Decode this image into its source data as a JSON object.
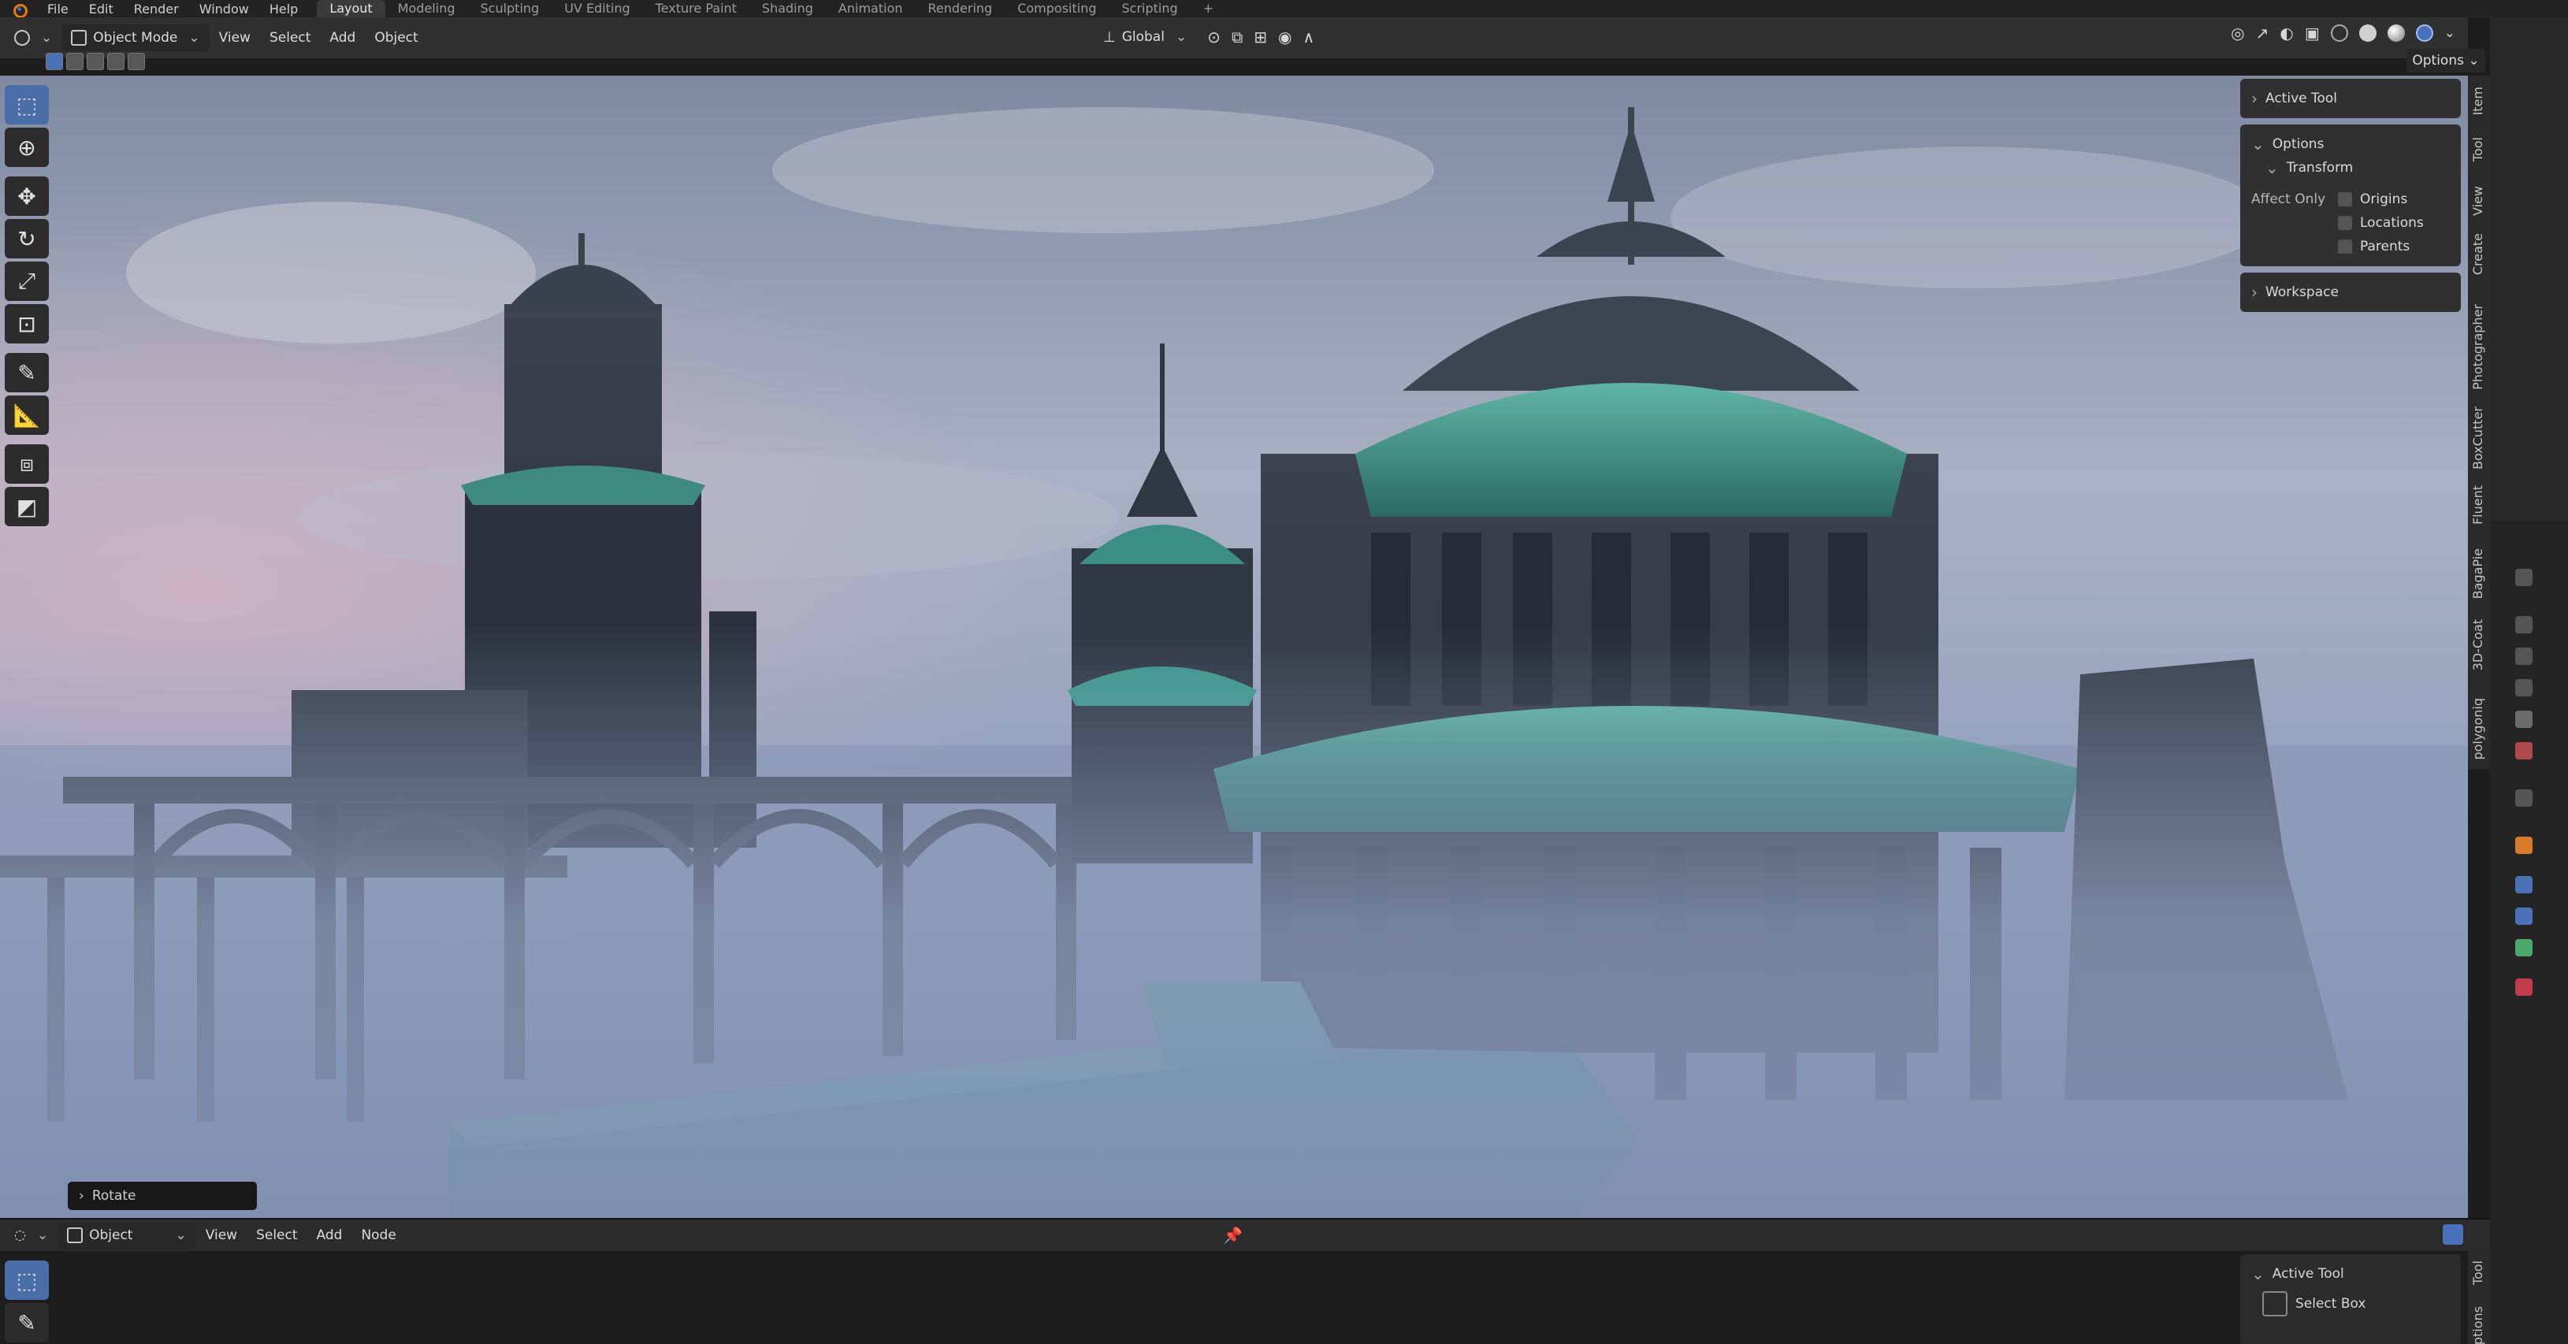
{
  "topbar": {
    "menu": [
      "File",
      "Edit",
      "Render",
      "Window",
      "Help"
    ],
    "workspaces": [
      "Layout",
      "Modeling",
      "Sculpting",
      "UV Editing",
      "Texture Paint",
      "Shading",
      "Animation",
      "Rendering",
      "Compositing",
      "Scripting",
      "+"
    ],
    "active_workspace": "Layout"
  },
  "viewport_header": {
    "mode": "Object Mode",
    "menus": [
      "View",
      "Select",
      "Add",
      "Object"
    ],
    "transform_orientation": "Global",
    "options_label": "Options"
  },
  "tool_panel": {
    "sections": {
      "active_tool": "Active Tool",
      "options": "Options",
      "transform": "Transform",
      "affect_only": "Affect Only",
      "checkboxes": [
        "Origins",
        "Locations",
        "Parents"
      ],
      "workspace": "Workspace"
    }
  },
  "side_tabs": [
    "Item",
    "Tool",
    "View",
    "Create",
    "Photographer",
    "BoxCutter",
    "Fluent",
    "BagaPie",
    "3D-Coat",
    "polygoniq"
  ],
  "redo_panel": {
    "label": "Rotate"
  },
  "bottom_editor": {
    "type": "Object",
    "menus": [
      "View",
      "Select",
      "Add",
      "Node"
    ],
    "active_tool_label": "Active Tool",
    "select_box_label": "Select Box",
    "side_tabs": [
      "Tool",
      "Options"
    ]
  },
  "colors": {
    "accent": "#4a72b8",
    "panel": "#303030",
    "header": "#232323",
    "copper": "#3f9c8c"
  }
}
